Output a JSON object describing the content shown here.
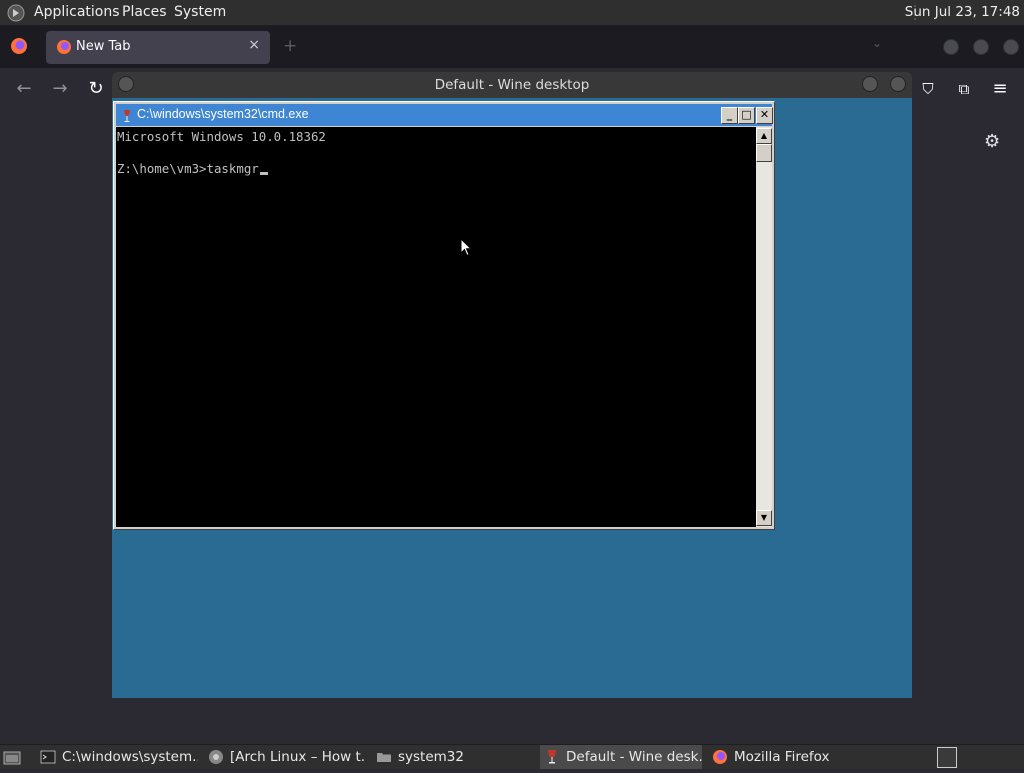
{
  "top_panel": {
    "menus": [
      "Applications",
      "Places",
      "System"
    ],
    "clock": "Sun Jul 23, 17:48"
  },
  "firefox": {
    "tab_title": "New Tab",
    "tab_close": "×",
    "new_tab": "+",
    "tab_list": "⌄",
    "toolbar": {
      "back": "←",
      "forward": "→",
      "reload": "↻",
      "pocket": "⛉",
      "extensions": "⧉",
      "menu": "≡"
    },
    "settings": "⚙"
  },
  "wine_desktop": {
    "title": "Default - Wine desktop"
  },
  "cmd": {
    "title": "C:\\windows\\system32\\cmd.exe",
    "buttons": {
      "minimize": "_",
      "maximize": "□",
      "close": "✕"
    },
    "lines": [
      "Microsoft Windows 10.0.18362",
      "",
      "Z:\\home\\vm3>taskmgr"
    ],
    "scroll_up": "▲",
    "scroll_down": "▼"
  },
  "taskbar": {
    "items": [
      {
        "label": "C:\\windows\\system...",
        "icon": "terminal-icon",
        "active": false
      },
      {
        "label": "[Arch Linux – How t...",
        "icon": "chrome-icon",
        "active": false
      },
      {
        "label": "system32",
        "icon": "folder-icon",
        "active": false
      },
      {
        "label": "Default - Wine desk...",
        "icon": "wine-icon",
        "active": true
      },
      {
        "label": "Mozilla Firefox",
        "icon": "firefox-icon",
        "active": false
      }
    ]
  },
  "colors": {
    "wine_desktop_bg": "#2a6b93",
    "cmd_titlebar": "#3e86d4",
    "firefox_bg": "#2b2a33"
  }
}
